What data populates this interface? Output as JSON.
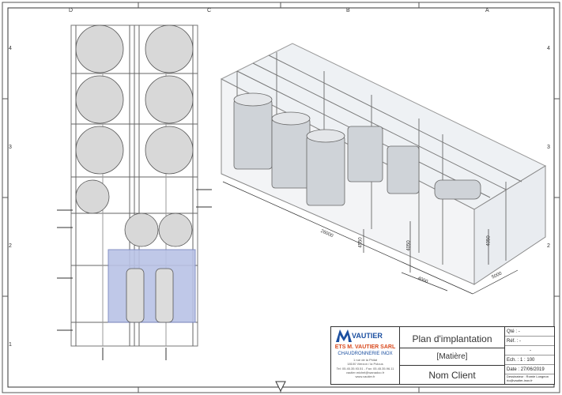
{
  "sheet": {
    "columns": [
      "D",
      "C",
      "B",
      "A"
    ],
    "rows": [
      "4",
      "3",
      "2",
      "1"
    ]
  },
  "title_block": {
    "plan_title": "Plan d'implantation",
    "material": "[Matière]",
    "client": "Nom Client",
    "qty_label": "Qté :",
    "qty_value": "-",
    "ref_label": "Réf. :",
    "ref_value": "-",
    "extra_value": "-",
    "scale_label": "Ech. :",
    "scale_value": "1 : 100",
    "date_label": "Date :",
    "date_value": "27/06/2019",
    "designer_label": "Dessinateur : Romie Longeon",
    "designer_email": "rlo@vautier-inox.fr",
    "logo_text": "VAUTIER",
    "company_name": "ETS M. VAUTIER SARL",
    "company_sub": "CHAUDRONNERIE INOX",
    "address1": "1 rue de la Philat",
    "address2": "18100 Vierzon / la Polous",
    "phone": "Tel: 05.45.35.93.51 - Fax: 05.45.35.96.11",
    "email": "vautier.michel@wanadoo.fr",
    "web": "www.vautier.fr"
  },
  "dimensions": {
    "length": "26000",
    "width": "4000",
    "height_right": "5000",
    "h1": "4050",
    "h2": "4550",
    "h3": "4050"
  }
}
